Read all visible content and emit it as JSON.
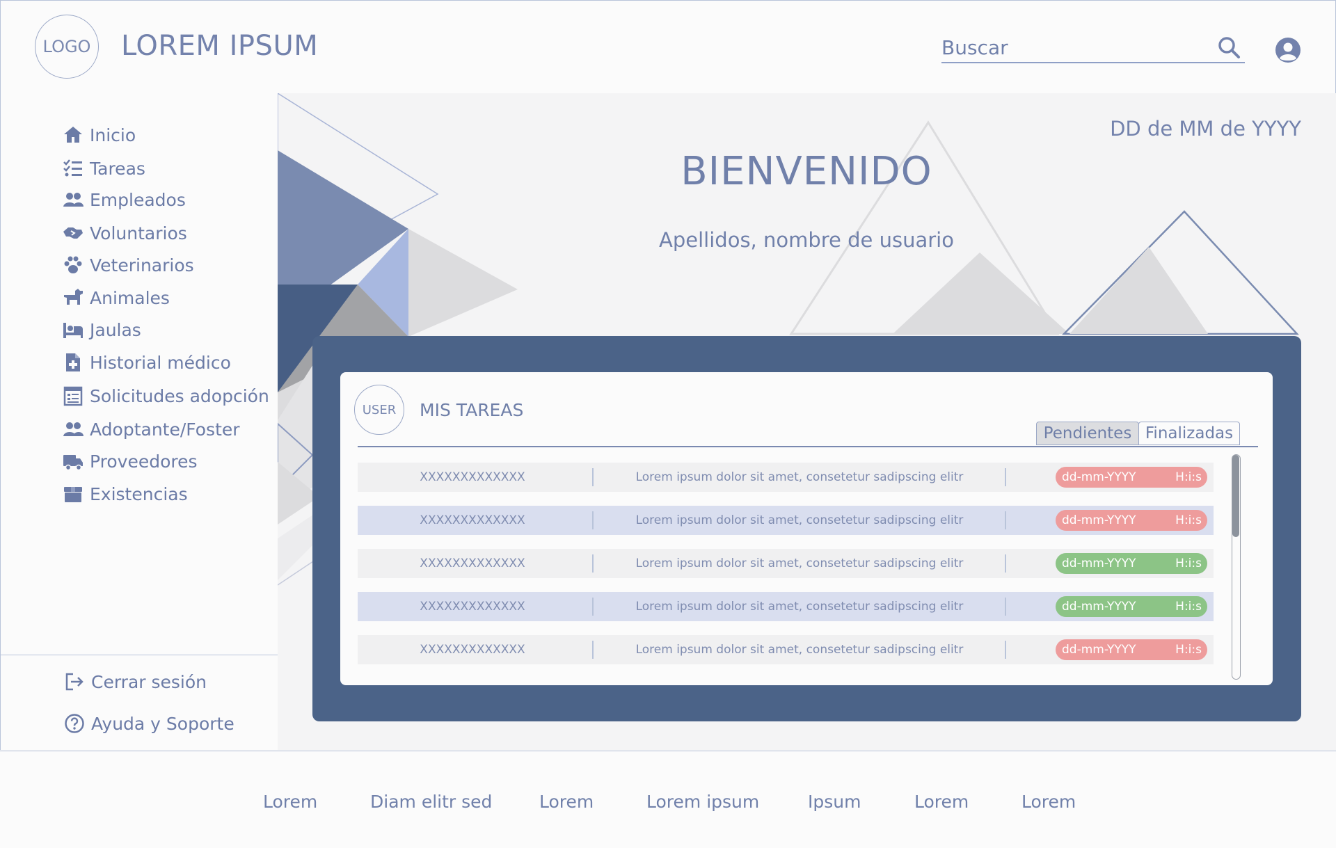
{
  "header": {
    "logo": "LOGO",
    "title": "LOREM IPSUM",
    "search_placeholder": "Buscar"
  },
  "sidebar": {
    "items": [
      {
        "label": "Inicio",
        "icon": "home-icon"
      },
      {
        "label": "Tareas",
        "icon": "task-list-icon"
      },
      {
        "label": "Empleados",
        "icon": "users-icon"
      },
      {
        "label": "Voluntarios",
        "icon": "handshake-icon"
      },
      {
        "label": "Veterinarios",
        "icon": "paw-icon"
      },
      {
        "label": "Animales",
        "icon": "dog-icon"
      },
      {
        "label": "Jaulas",
        "icon": "bed-icon"
      },
      {
        "label": "Historial médico",
        "icon": "medical-file-icon"
      },
      {
        "label": "Solicitudes adopción",
        "icon": "form-icon"
      },
      {
        "label": "Adoptante/Foster",
        "icon": "users-icon"
      },
      {
        "label": "Proveedores",
        "icon": "truck-icon"
      },
      {
        "label": "Existencias",
        "icon": "box-icon"
      }
    ],
    "bottom": [
      {
        "label": "Cerrar sesión",
        "icon": "logout-icon"
      },
      {
        "label": "Ayuda y Soporte",
        "icon": "help-icon"
      }
    ]
  },
  "main": {
    "date": "DD de MM de YYYY",
    "welcome": "BIENVENIDO",
    "user_name": "Apellidos, nombre de usuario",
    "tasks": {
      "avatar_label": "USER",
      "title": "MIS TAREAS",
      "tabs": [
        {
          "label": "Pendientes",
          "active": true
        },
        {
          "label": "Finalizadas",
          "active": false
        }
      ],
      "rows": [
        {
          "code": "XXXXXXXXXXXXX",
          "desc": "Lorem ipsum dolor sit amet, consetetur sadipscing elitr",
          "date": "dd-mm-YYYY",
          "time": "H:i:s",
          "status": "red"
        },
        {
          "code": "XXXXXXXXXXXXX",
          "desc": "Lorem ipsum dolor sit amet, consetetur sadipscing elitr",
          "date": "dd-mm-YYYY",
          "time": "H:i:s",
          "status": "red"
        },
        {
          "code": "XXXXXXXXXXXXX",
          "desc": "Lorem ipsum dolor sit amet, consetetur sadipscing elitr",
          "date": "dd-mm-YYYY",
          "time": "H:i:s",
          "status": "green"
        },
        {
          "code": "XXXXXXXXXXXXX",
          "desc": "Lorem ipsum dolor sit amet, consetetur sadipscing elitr",
          "date": "dd-mm-YYYY",
          "time": "H:i:s",
          "status": "green"
        },
        {
          "code": "XXXXXXXXXXXXX",
          "desc": "Lorem ipsum dolor sit amet, consetetur sadipscing elitr",
          "date": "dd-mm-YYYY",
          "time": "H:i:s",
          "status": "red"
        }
      ]
    }
  },
  "footer": {
    "links": [
      "Lorem",
      "Diam elitr sed",
      "Lorem",
      "Lorem ipsum",
      "Ipsum",
      "Lorem",
      "Lorem"
    ]
  },
  "colors": {
    "accent": "#4b6388",
    "text": "#6f7fa8",
    "status_red": "#ee9c9c",
    "status_green": "#8cc486",
    "row_highlight": "#d9deef"
  }
}
